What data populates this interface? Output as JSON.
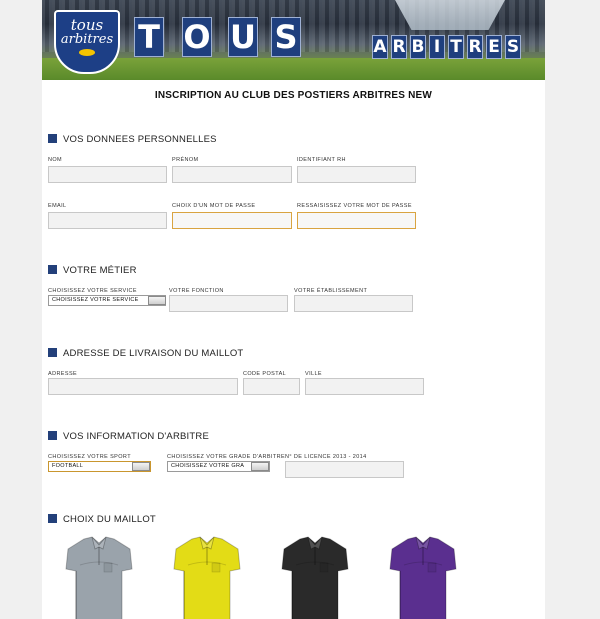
{
  "banner": {
    "logo_line1": "tous",
    "logo_line2": "arbitres",
    "big_word": [
      "T",
      "O",
      "U",
      "S"
    ],
    "small_word": [
      "A",
      "R",
      "B",
      "I",
      "T",
      "R",
      "E",
      "S"
    ]
  },
  "form_title": "INSCRIPTION AU CLUB DES POSTIERS ARBITRES NEW",
  "sections": {
    "personal": {
      "title": "VOS DONNEES PERSONNELLES",
      "nom": "NOM",
      "prenom": "PRÉNOM",
      "identifiant": "IDENTIFIANT RH",
      "email": "EMAIL",
      "password": "CHOIX D'UN MOT DE PASSE",
      "password_confirm": "RESSAISISSEZ VOTRE MOT DE PASSE"
    },
    "job": {
      "title": "VOTRE MÉTIER",
      "service_label": "CHOISISSEZ VOTRE SERVICE",
      "service_value": "CHOISISSEZ VOTRE SERVICE",
      "fonction": "VOTRE FONCTION",
      "etablissement": "VOTRE ÉTABLISSEMENT"
    },
    "delivery": {
      "title": "ADRESSE DE LIVRAISON DU MAILLOT",
      "adresse": "ADRESSE",
      "code_postal": "CODE POSTAL",
      "ville": "VILLE"
    },
    "referee": {
      "title": "VOS INFORMATION D'ARBITRE",
      "sport_label": "CHOISISSEZ VOTRE SPORT",
      "sport_value": "FOOTBALL",
      "grade_label": "CHOISISSEZ VOTRE GRADE D'ARBITRE",
      "grade_value": "CHOISISSEZ VOTRE GRA",
      "licence": "N° DE LICENCE 2013 - 2014"
    },
    "jersey": {
      "title": "CHOIX DU MAILLOT",
      "colors": [
        "#9aa3ab",
        "#e3dc16",
        "#2a2a2a",
        "#5a2f8f"
      ],
      "color_names": [
        "grey-shirt",
        "yellow-shirt",
        "black-shirt",
        "purple-shirt"
      ]
    }
  }
}
